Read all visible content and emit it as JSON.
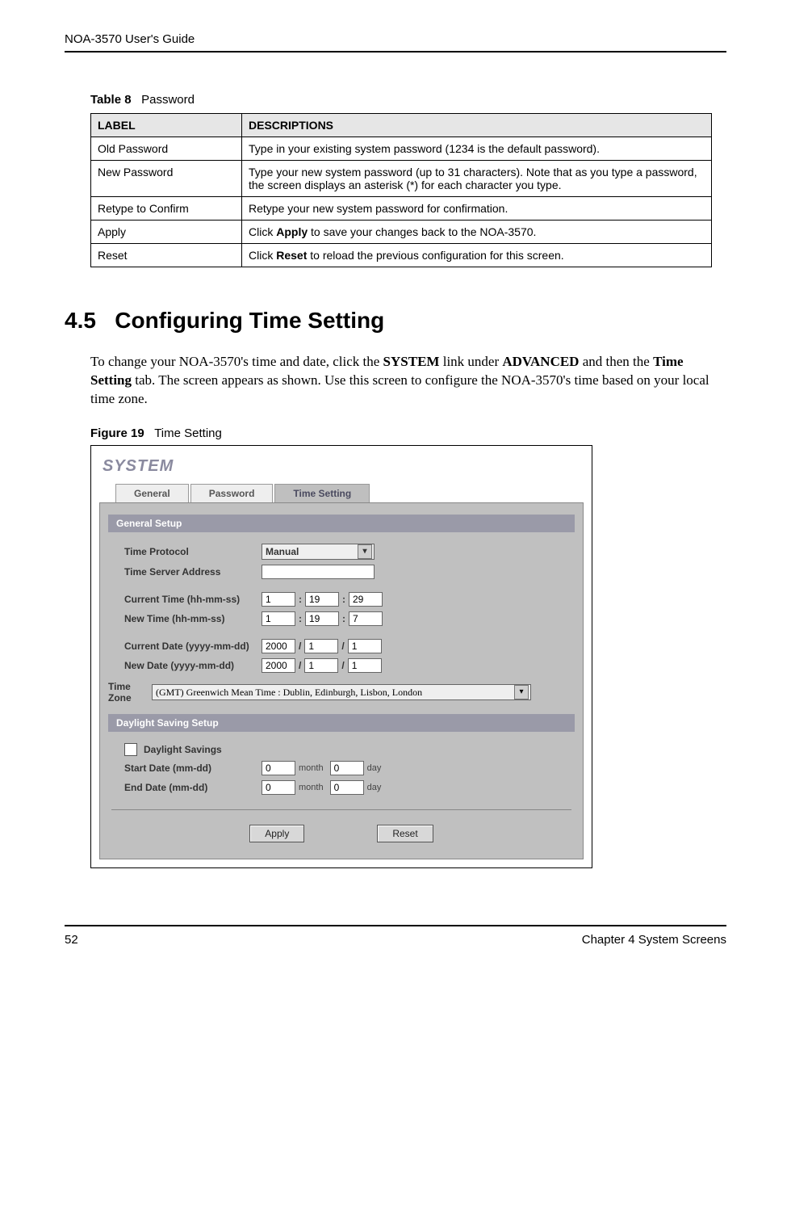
{
  "header": {
    "guide_title": "NOA-3570 User's Guide"
  },
  "table": {
    "caption_prefix": "Table 8",
    "caption_name": "Password",
    "headers": {
      "col1": "LABEL",
      "col2": "DESCRIPTIONS"
    },
    "rows": [
      {
        "label": "Old Password",
        "desc": "Type in your existing system password (1234 is the default password)."
      },
      {
        "label": "New Password",
        "desc": "Type your new system password (up to 31 characters). Note that as you type a password, the screen displays an asterisk (*) for each character you type."
      },
      {
        "label": "Retype to Confirm",
        "desc": "Retype your new system password for confirmation."
      },
      {
        "label": "Apply",
        "desc_pre": "Click ",
        "desc_bold": "Apply",
        "desc_post": " to save your changes back to the NOA-3570."
      },
      {
        "label": "Reset",
        "desc_pre": "Click ",
        "desc_bold": "Reset",
        "desc_post": " to reload the previous configuration for this screen."
      }
    ]
  },
  "section": {
    "number": "4.5",
    "title": "Configuring Time Setting",
    "paragraph_pre": "To change your NOA-3570's time and date, click the ",
    "paragraph_b1": "SYSTEM",
    "paragraph_mid1": " link under ",
    "paragraph_b2": "ADVANCED",
    "paragraph_mid2": " and then the ",
    "paragraph_b3": "Time Setting",
    "paragraph_post": " tab. The screen appears as shown. Use this screen to configure the NOA-3570's time based on your local time zone."
  },
  "figure": {
    "caption_prefix": "Figure 19",
    "caption_name": "Time Setting",
    "system_title": "SYSTEM",
    "tabs": {
      "general": "General",
      "password": "Password",
      "time": "Time Setting"
    },
    "sections": {
      "general_setup": "General Setup",
      "daylight": "Daylight Saving Setup"
    },
    "labels": {
      "time_protocol": "Time Protocol",
      "time_server": "Time Server Address",
      "current_time": "Current Time (hh-mm-ss)",
      "new_time": "New Time (hh-mm-ss)",
      "current_date": "Current Date (yyyy-mm-dd)",
      "new_date": "New Date (yyyy-mm-dd)",
      "time_zone_a": "Time",
      "time_zone_b": "Zone",
      "daylight_savings": "Daylight Savings",
      "start_date": "Start Date (mm-dd)",
      "end_date": "End Date (mm-dd)",
      "month": "month",
      "day": "day"
    },
    "values": {
      "time_protocol": "Manual",
      "time_server": "",
      "current_time": {
        "hh": "1",
        "mm": "19",
        "ss": "29"
      },
      "new_time": {
        "hh": "1",
        "mm": "19",
        "ss": "7"
      },
      "current_date": {
        "y": "2000",
        "m": "1",
        "d": "1"
      },
      "new_date": {
        "y": "2000",
        "m": "1",
        "d": "1"
      },
      "time_zone": "(GMT) Greenwich Mean Time : Dublin, Edinburgh, Lisbon, London",
      "start_date": {
        "month": "0",
        "day": "0"
      },
      "end_date": {
        "month": "0",
        "day": "0"
      }
    },
    "buttons": {
      "apply": "Apply",
      "reset": "Reset"
    }
  },
  "footer": {
    "page": "52",
    "chapter": "Chapter 4 System Screens"
  }
}
